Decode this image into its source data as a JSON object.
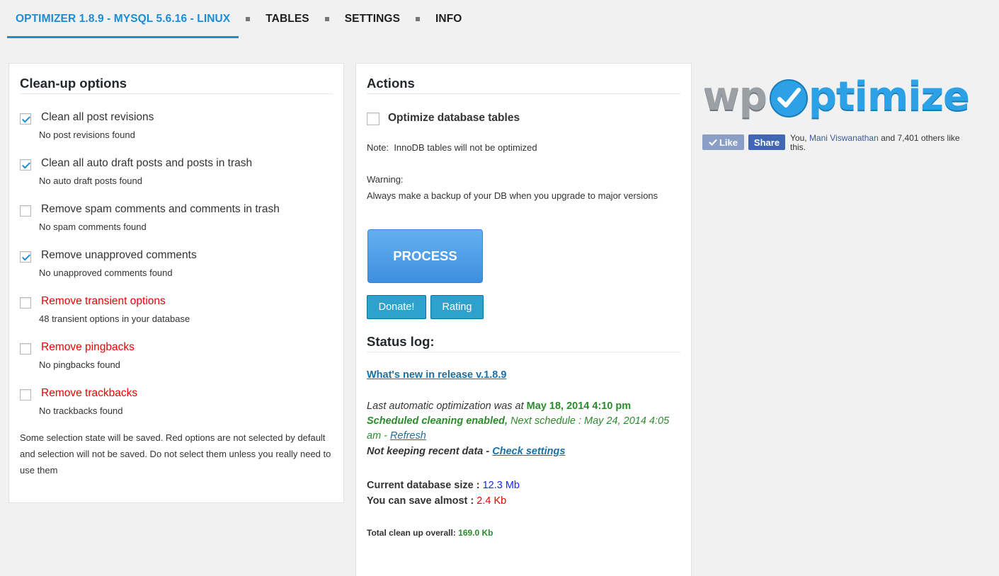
{
  "tabs": [
    {
      "label": "OPTIMIZER 1.8.9 - MYSQL 5.6.16 - LINUX",
      "active": true
    },
    {
      "label": "TABLES",
      "active": false
    },
    {
      "label": "SETTINGS",
      "active": false
    },
    {
      "label": "INFO",
      "active": false
    }
  ],
  "cleanup": {
    "title": "Clean-up options",
    "options": [
      {
        "label": "Clean all post revisions",
        "note": "No post revisions found",
        "checked": true,
        "red": false
      },
      {
        "label": "Clean all auto draft posts and posts in trash",
        "note": "No auto draft posts found",
        "checked": true,
        "red": false
      },
      {
        "label": "Remove spam comments and comments in trash",
        "note": "No spam comments found",
        "checked": false,
        "red": false
      },
      {
        "label": "Remove unapproved comments",
        "note": "No unapproved comments found",
        "checked": true,
        "red": false
      },
      {
        "label": "Remove transient options",
        "note": "48 transient options in your database",
        "checked": false,
        "red": true
      },
      {
        "label": "Remove pingbacks",
        "note": "No pingbacks found",
        "checked": false,
        "red": true
      },
      {
        "label": "Remove trackbacks",
        "note": "No trackbacks found",
        "checked": false,
        "red": true
      }
    ],
    "footnote": "Some selection state will be saved. Red options are not selected by default and selection will not be saved. Do not select them unless you really need to use them"
  },
  "actions": {
    "title": "Actions",
    "optimize_label": "Optimize database tables",
    "optimize_checked": false,
    "note_label": "Note:",
    "note_text": "InnoDB tables will not be optimized",
    "warning_label": "Warning:",
    "warning_text": "Always make a backup of your DB when you upgrade to major versions",
    "process_label": "PROCESS",
    "donate_label": "Donate!",
    "rating_label": "Rating"
  },
  "status": {
    "title": "Status log:",
    "whats_new": "What's new in release v.1.8.9",
    "last_auto_prefix": "Last automatic optimization was at",
    "last_auto_date": "May 18, 2014 4:10 pm",
    "scheduled_enabled": "Scheduled cleaning enabled,",
    "next_schedule": "Next schedule : May 24, 2014 4:05 am -",
    "refresh_link": "Refresh",
    "not_keeping": "Not keeping recent data -",
    "check_settings": "Check settings",
    "db_size_label": "Current database size :",
    "db_size_value": "12.3 Mb",
    "save_label": "You can save almost :",
    "save_value": "2.4 Kb",
    "total_label": "Total clean up overall:",
    "total_value": "169.0 Kb"
  },
  "brand": {
    "logo_wp": "wp",
    "logo_rest": "ptimize",
    "like_label": "Like",
    "share_label": "Share",
    "fb_prefix": "You,",
    "fb_name": "Mani Viswanathan",
    "fb_suffix": "and 7,401 others like this."
  }
}
